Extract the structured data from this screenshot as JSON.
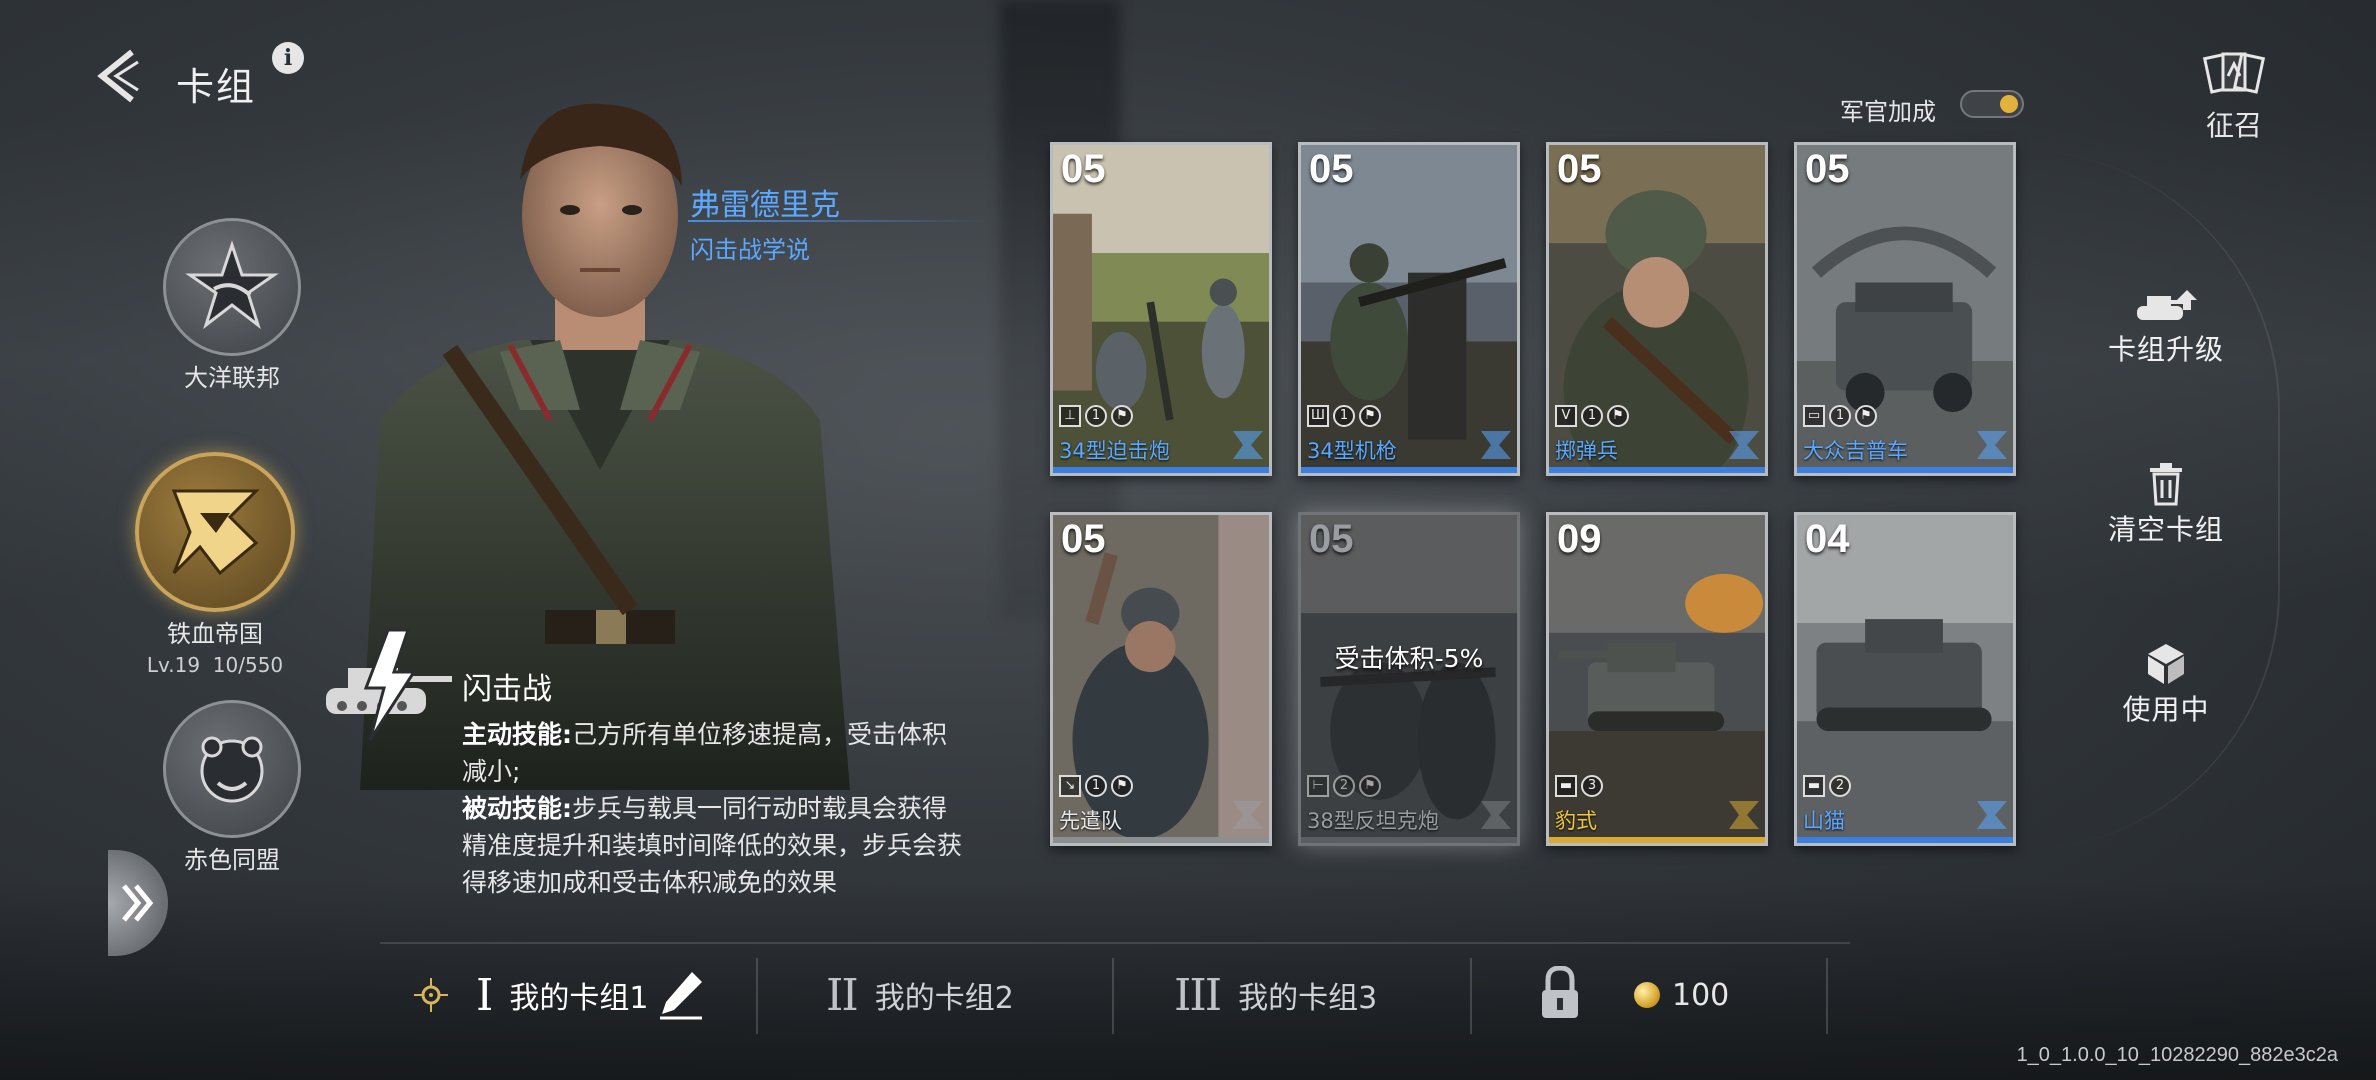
{
  "header": {
    "title": "卡组"
  },
  "factions": [
    {
      "name": "大洋联邦"
    },
    {
      "name": "铁血帝国",
      "level": "Lv.19",
      "exp": "10/550"
    },
    {
      "name": "赤色同盟"
    }
  ],
  "commander": {
    "name": "弗雷德里克",
    "doctrine": "闪击战学说",
    "skill_name": "闪击战",
    "active_label": "主动技能:",
    "active_text": "己方所有单位移速提高，受击体积减小;",
    "passive_label": "被动技能:",
    "passive_text": "步兵与载具一同行动时载具会获得精准度提升和装填时间降低的效果，步兵会获得移速加成和受击体积减免的效果"
  },
  "officer_bonus": {
    "label": "军官加成",
    "on": true
  },
  "recruit": {
    "label": "征召"
  },
  "side_menu": {
    "upgrade": "卡组升级",
    "clear": "清空卡组",
    "in_use": "使用中"
  },
  "cards": [
    {
      "cost": "05",
      "name": "34型迫击炮",
      "type_icon": "mortar-icon",
      "count": "1",
      "rarity": "blue"
    },
    {
      "cost": "05",
      "name": "34型机枪",
      "type_icon": "machinegun-icon",
      "count": "1",
      "rarity": "blue"
    },
    {
      "cost": "05",
      "name": "掷弹兵",
      "type_icon": "grenadier-icon",
      "count": "1",
      "rarity": "blue"
    },
    {
      "cost": "05",
      "name": "大众吉普车",
      "type_icon": "vehicle-icon",
      "count": "1",
      "rarity": "blue"
    },
    {
      "cost": "05",
      "name": "先遣队",
      "type_icon": "scout-icon",
      "count": "1",
      "rarity": "blue"
    },
    {
      "cost": "05",
      "name": "38型反坦克炮",
      "type_icon": "at-gun-icon",
      "count": "2",
      "rarity": "disabled",
      "buff": "受击体积-5%"
    },
    {
      "cost": "09",
      "name": "豹式",
      "type_icon": "tank-icon",
      "count": "3",
      "rarity": "gold"
    },
    {
      "cost": "04",
      "name": "山猫",
      "type_icon": "tank-icon",
      "count": "2",
      "rarity": "blue"
    }
  ],
  "deck_tabs": [
    {
      "roman": "I",
      "label": "我的卡组1",
      "active": true
    },
    {
      "roman": "II",
      "label": "我的卡组2",
      "active": false
    },
    {
      "roman": "III",
      "label": "我的卡组3",
      "active": false
    }
  ],
  "unlock_cost": "100",
  "version": "1_0_1.0.0_10_10282290_882e3c2a",
  "colors": {
    "accent_blue": "#5aa8ff",
    "gold": "#d8aa32",
    "toggle_on": "#e3b23c"
  }
}
